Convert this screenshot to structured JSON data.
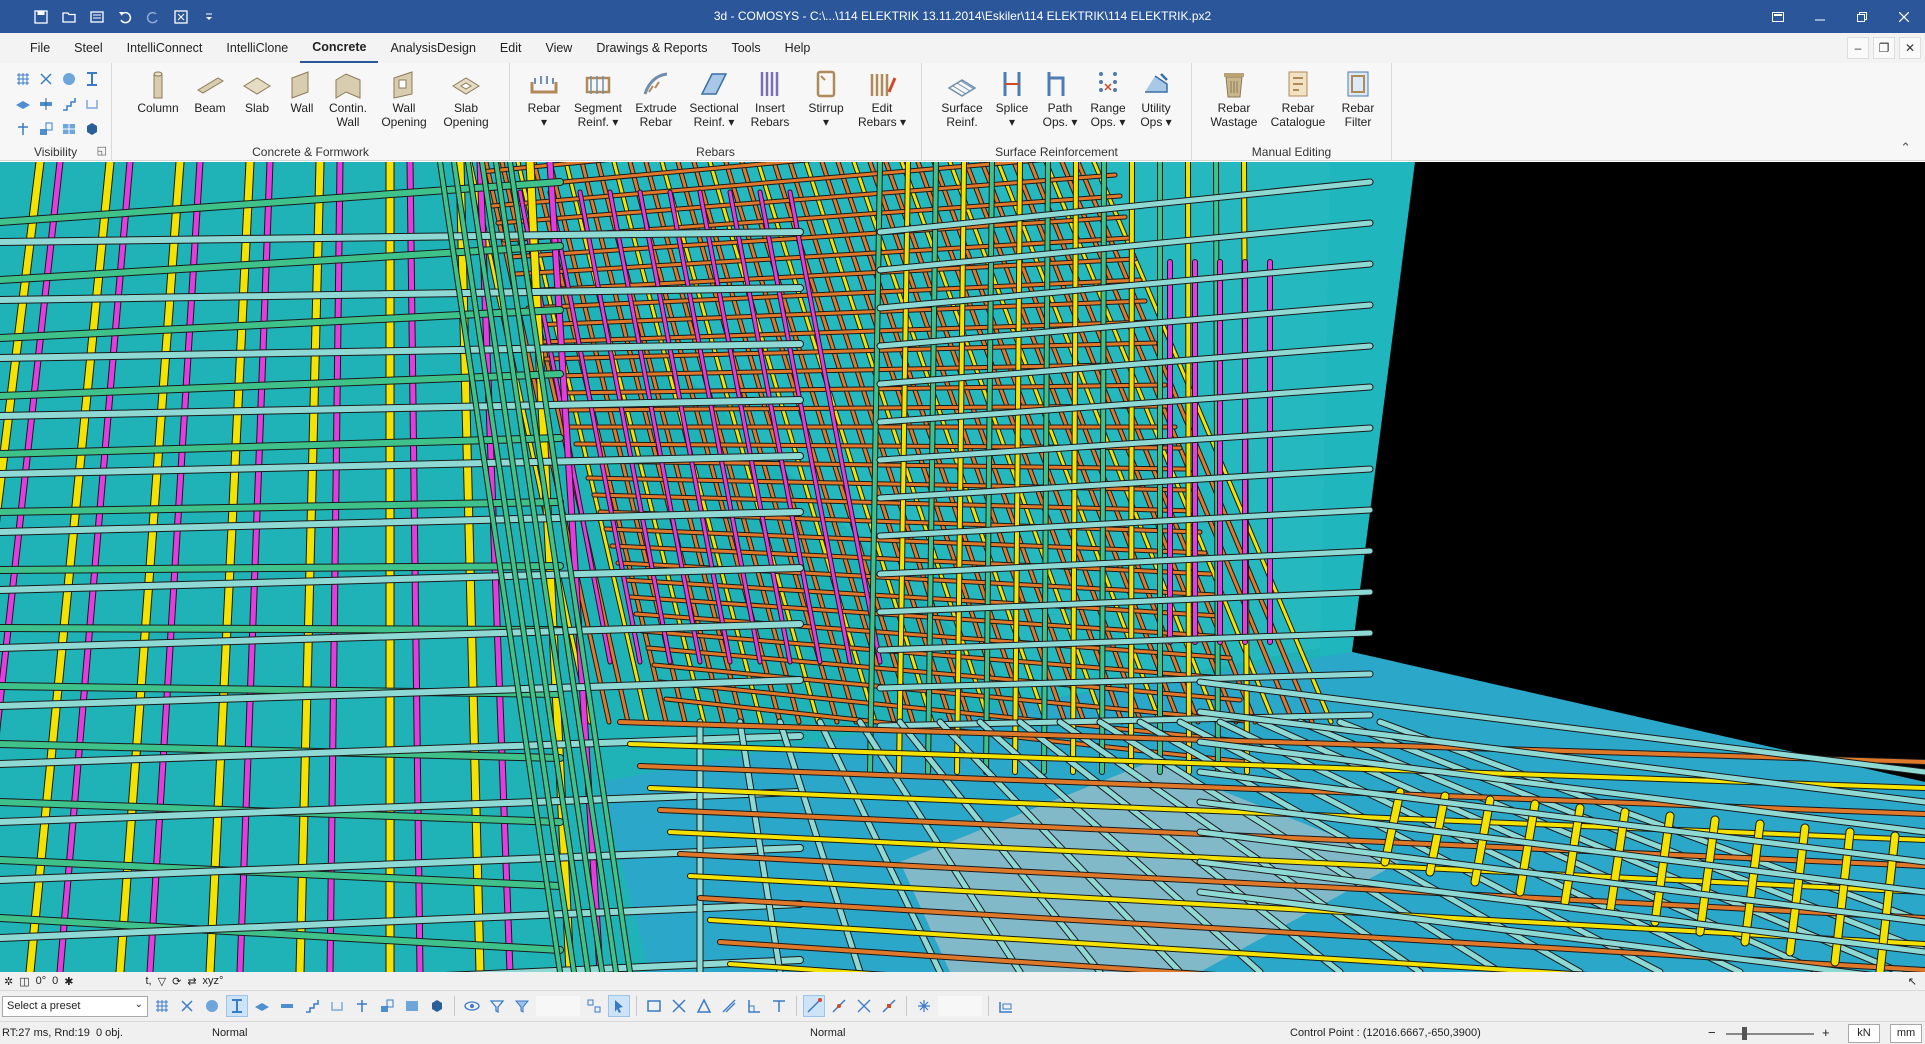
{
  "window": {
    "title": "3d - COMOSYS - C:\\...\\114  ELEKTRIK 13.11.2014\\Eskiler\\114  ELEKTRIK\\114  ELEKTRIK.px2"
  },
  "menu": {
    "tabs": [
      "File",
      "Steel",
      "IntelliConnect",
      "IntelliClone",
      "Concrete",
      "AnalysisDesign",
      "Edit",
      "View",
      "Drawings & Reports",
      "Tools",
      "Help"
    ],
    "active": "Concrete"
  },
  "ribbon": {
    "groups": {
      "visibility": "Visibility",
      "concrete_formwork": "Concrete & Formwork",
      "rebars": "Rebars",
      "surface_reinforcement": "Surface Reinforcement",
      "manual_editing": "Manual Editing"
    },
    "buttons": {
      "column": "Column",
      "beam": "Beam",
      "slab": "Slab",
      "wall": "Wall",
      "contin_wall": "Contin.\nWall",
      "wall_opening": "Wall\nOpening",
      "slab_opening": "Slab\nOpening",
      "rebar": "Rebar\n▾",
      "segment_reinf": "Segment\nReinf. ▾",
      "extrude_rebar": "Extrude\nRebar",
      "sectional_reinf": "Sectional\nReinf. ▾",
      "insert_rebars": "Insert\nRebars",
      "stirrup": "Stirrup\n▾",
      "edit_rebars": "Edit\nRebars ▾",
      "surface_reinf": "Surface\nReinf.",
      "splice": "Splice\n▾",
      "path_ops": "Path\nOps. ▾",
      "range_ops": "Range\nOps. ▾",
      "utility_ops": "Utility\nOps ▾",
      "rebar_wastage": "Rebar\nWastage",
      "rebar_catalogue": "Rebar\nCatalogue",
      "rebar_filter": "Rebar\nFilter"
    }
  },
  "viewbar": {
    "angle": "0°",
    "zero": "0",
    "t_label": "t,",
    "xyz": "xyz°"
  },
  "toolbar": {
    "preset_placeholder": "Select a preset"
  },
  "status": {
    "render_time": "RT:27 ms, Rnd:19",
    "objects": "0 obj.",
    "mode1": "Normal",
    "mode2": "Normal",
    "control_point": "Control Point : (12016.6667,-650,3900)",
    "unit_force": "kN",
    "unit_length": "mm"
  },
  "colors": {
    "titlebar": "#2b579a",
    "concrete": "#1fb3b8",
    "rebar_yellow": "#f4e300",
    "rebar_magenta": "#e43ce0",
    "rebar_orange": "#e0782a",
    "rebar_green": "#3fc28a",
    "rebar_cyan": "#8fd9d4"
  }
}
